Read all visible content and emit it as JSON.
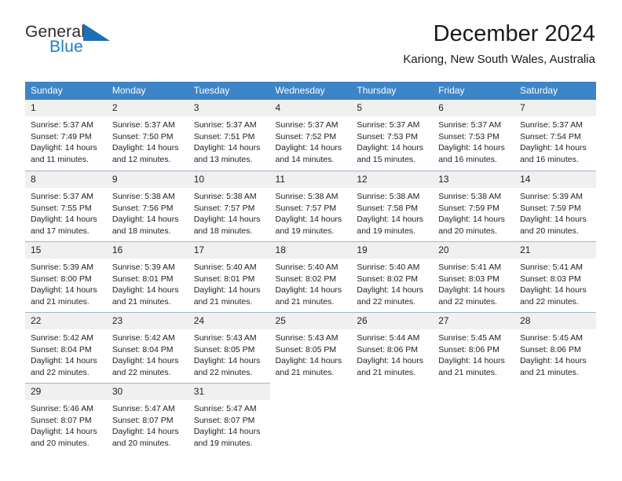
{
  "brand": {
    "name_part1": "General",
    "name_part2": "Blue",
    "triangle_color": "#1e6fb5",
    "blue_color": "#1e7fc4"
  },
  "header": {
    "title": "December 2024",
    "subtitle": "Kariong, New South Wales, Australia"
  },
  "theme": {
    "header_bar_color": "#3d85c6",
    "daynum_bg": "#f0f0f0",
    "row_divider": "#9db7d0",
    "text_color": "#222222"
  },
  "weekday_headers": [
    "Sunday",
    "Monday",
    "Tuesday",
    "Wednesday",
    "Thursday",
    "Friday",
    "Saturday"
  ],
  "labels": {
    "sunrise_prefix": "Sunrise:",
    "sunset_prefix": "Sunset:",
    "daylight_prefix": "Daylight:"
  },
  "weeks": [
    {
      "days": [
        {
          "num": "1",
          "sunrise": "Sunrise: 5:37 AM",
          "sunset": "Sunset: 7:49 PM",
          "daylight_line1": "Daylight: 14 hours",
          "daylight_line2": "and 11 minutes."
        },
        {
          "num": "2",
          "sunrise": "Sunrise: 5:37 AM",
          "sunset": "Sunset: 7:50 PM",
          "daylight_line1": "Daylight: 14 hours",
          "daylight_line2": "and 12 minutes."
        },
        {
          "num": "3",
          "sunrise": "Sunrise: 5:37 AM",
          "sunset": "Sunset: 7:51 PM",
          "daylight_line1": "Daylight: 14 hours",
          "daylight_line2": "and 13 minutes."
        },
        {
          "num": "4",
          "sunrise": "Sunrise: 5:37 AM",
          "sunset": "Sunset: 7:52 PM",
          "daylight_line1": "Daylight: 14 hours",
          "daylight_line2": "and 14 minutes."
        },
        {
          "num": "5",
          "sunrise": "Sunrise: 5:37 AM",
          "sunset": "Sunset: 7:53 PM",
          "daylight_line1": "Daylight: 14 hours",
          "daylight_line2": "and 15 minutes."
        },
        {
          "num": "6",
          "sunrise": "Sunrise: 5:37 AM",
          "sunset": "Sunset: 7:53 PM",
          "daylight_line1": "Daylight: 14 hours",
          "daylight_line2": "and 16 minutes."
        },
        {
          "num": "7",
          "sunrise": "Sunrise: 5:37 AM",
          "sunset": "Sunset: 7:54 PM",
          "daylight_line1": "Daylight: 14 hours",
          "daylight_line2": "and 16 minutes."
        }
      ]
    },
    {
      "days": [
        {
          "num": "8",
          "sunrise": "Sunrise: 5:37 AM",
          "sunset": "Sunset: 7:55 PM",
          "daylight_line1": "Daylight: 14 hours",
          "daylight_line2": "and 17 minutes."
        },
        {
          "num": "9",
          "sunrise": "Sunrise: 5:38 AM",
          "sunset": "Sunset: 7:56 PM",
          "daylight_line1": "Daylight: 14 hours",
          "daylight_line2": "and 18 minutes."
        },
        {
          "num": "10",
          "sunrise": "Sunrise: 5:38 AM",
          "sunset": "Sunset: 7:57 PM",
          "daylight_line1": "Daylight: 14 hours",
          "daylight_line2": "and 18 minutes."
        },
        {
          "num": "11",
          "sunrise": "Sunrise: 5:38 AM",
          "sunset": "Sunset: 7:57 PM",
          "daylight_line1": "Daylight: 14 hours",
          "daylight_line2": "and 19 minutes."
        },
        {
          "num": "12",
          "sunrise": "Sunrise: 5:38 AM",
          "sunset": "Sunset: 7:58 PM",
          "daylight_line1": "Daylight: 14 hours",
          "daylight_line2": "and 19 minutes."
        },
        {
          "num": "13",
          "sunrise": "Sunrise: 5:38 AM",
          "sunset": "Sunset: 7:59 PM",
          "daylight_line1": "Daylight: 14 hours",
          "daylight_line2": "and 20 minutes."
        },
        {
          "num": "14",
          "sunrise": "Sunrise: 5:39 AM",
          "sunset": "Sunset: 7:59 PM",
          "daylight_line1": "Daylight: 14 hours",
          "daylight_line2": "and 20 minutes."
        }
      ]
    },
    {
      "days": [
        {
          "num": "15",
          "sunrise": "Sunrise: 5:39 AM",
          "sunset": "Sunset: 8:00 PM",
          "daylight_line1": "Daylight: 14 hours",
          "daylight_line2": "and 21 minutes."
        },
        {
          "num": "16",
          "sunrise": "Sunrise: 5:39 AM",
          "sunset": "Sunset: 8:01 PM",
          "daylight_line1": "Daylight: 14 hours",
          "daylight_line2": "and 21 minutes."
        },
        {
          "num": "17",
          "sunrise": "Sunrise: 5:40 AM",
          "sunset": "Sunset: 8:01 PM",
          "daylight_line1": "Daylight: 14 hours",
          "daylight_line2": "and 21 minutes."
        },
        {
          "num": "18",
          "sunrise": "Sunrise: 5:40 AM",
          "sunset": "Sunset: 8:02 PM",
          "daylight_line1": "Daylight: 14 hours",
          "daylight_line2": "and 21 minutes."
        },
        {
          "num": "19",
          "sunrise": "Sunrise: 5:40 AM",
          "sunset": "Sunset: 8:02 PM",
          "daylight_line1": "Daylight: 14 hours",
          "daylight_line2": "and 22 minutes."
        },
        {
          "num": "20",
          "sunrise": "Sunrise: 5:41 AM",
          "sunset": "Sunset: 8:03 PM",
          "daylight_line1": "Daylight: 14 hours",
          "daylight_line2": "and 22 minutes."
        },
        {
          "num": "21",
          "sunrise": "Sunrise: 5:41 AM",
          "sunset": "Sunset: 8:03 PM",
          "daylight_line1": "Daylight: 14 hours",
          "daylight_line2": "and 22 minutes."
        }
      ]
    },
    {
      "days": [
        {
          "num": "22",
          "sunrise": "Sunrise: 5:42 AM",
          "sunset": "Sunset: 8:04 PM",
          "daylight_line1": "Daylight: 14 hours",
          "daylight_line2": "and 22 minutes."
        },
        {
          "num": "23",
          "sunrise": "Sunrise: 5:42 AM",
          "sunset": "Sunset: 8:04 PM",
          "daylight_line1": "Daylight: 14 hours",
          "daylight_line2": "and 22 minutes."
        },
        {
          "num": "24",
          "sunrise": "Sunrise: 5:43 AM",
          "sunset": "Sunset: 8:05 PM",
          "daylight_line1": "Daylight: 14 hours",
          "daylight_line2": "and 22 minutes."
        },
        {
          "num": "25",
          "sunrise": "Sunrise: 5:43 AM",
          "sunset": "Sunset: 8:05 PM",
          "daylight_line1": "Daylight: 14 hours",
          "daylight_line2": "and 21 minutes."
        },
        {
          "num": "26",
          "sunrise": "Sunrise: 5:44 AM",
          "sunset": "Sunset: 8:06 PM",
          "daylight_line1": "Daylight: 14 hours",
          "daylight_line2": "and 21 minutes."
        },
        {
          "num": "27",
          "sunrise": "Sunrise: 5:45 AM",
          "sunset": "Sunset: 8:06 PM",
          "daylight_line1": "Daylight: 14 hours",
          "daylight_line2": "and 21 minutes."
        },
        {
          "num": "28",
          "sunrise": "Sunrise: 5:45 AM",
          "sunset": "Sunset: 8:06 PM",
          "daylight_line1": "Daylight: 14 hours",
          "daylight_line2": "and 21 minutes."
        }
      ]
    },
    {
      "days": [
        {
          "num": "29",
          "sunrise": "Sunrise: 5:46 AM",
          "sunset": "Sunset: 8:07 PM",
          "daylight_line1": "Daylight: 14 hours",
          "daylight_line2": "and 20 minutes."
        },
        {
          "num": "30",
          "sunrise": "Sunrise: 5:47 AM",
          "sunset": "Sunset: 8:07 PM",
          "daylight_line1": "Daylight: 14 hours",
          "daylight_line2": "and 20 minutes."
        },
        {
          "num": "31",
          "sunrise": "Sunrise: 5:47 AM",
          "sunset": "Sunset: 8:07 PM",
          "daylight_line1": "Daylight: 14 hours",
          "daylight_line2": "and 19 minutes."
        },
        {
          "num": "",
          "sunrise": "",
          "sunset": "",
          "daylight_line1": "",
          "daylight_line2": "",
          "empty": true
        },
        {
          "num": "",
          "sunrise": "",
          "sunset": "",
          "daylight_line1": "",
          "daylight_line2": "",
          "empty": true
        },
        {
          "num": "",
          "sunrise": "",
          "sunset": "",
          "daylight_line1": "",
          "daylight_line2": "",
          "empty": true
        },
        {
          "num": "",
          "sunrise": "",
          "sunset": "",
          "daylight_line1": "",
          "daylight_line2": "",
          "empty": true
        }
      ]
    }
  ]
}
